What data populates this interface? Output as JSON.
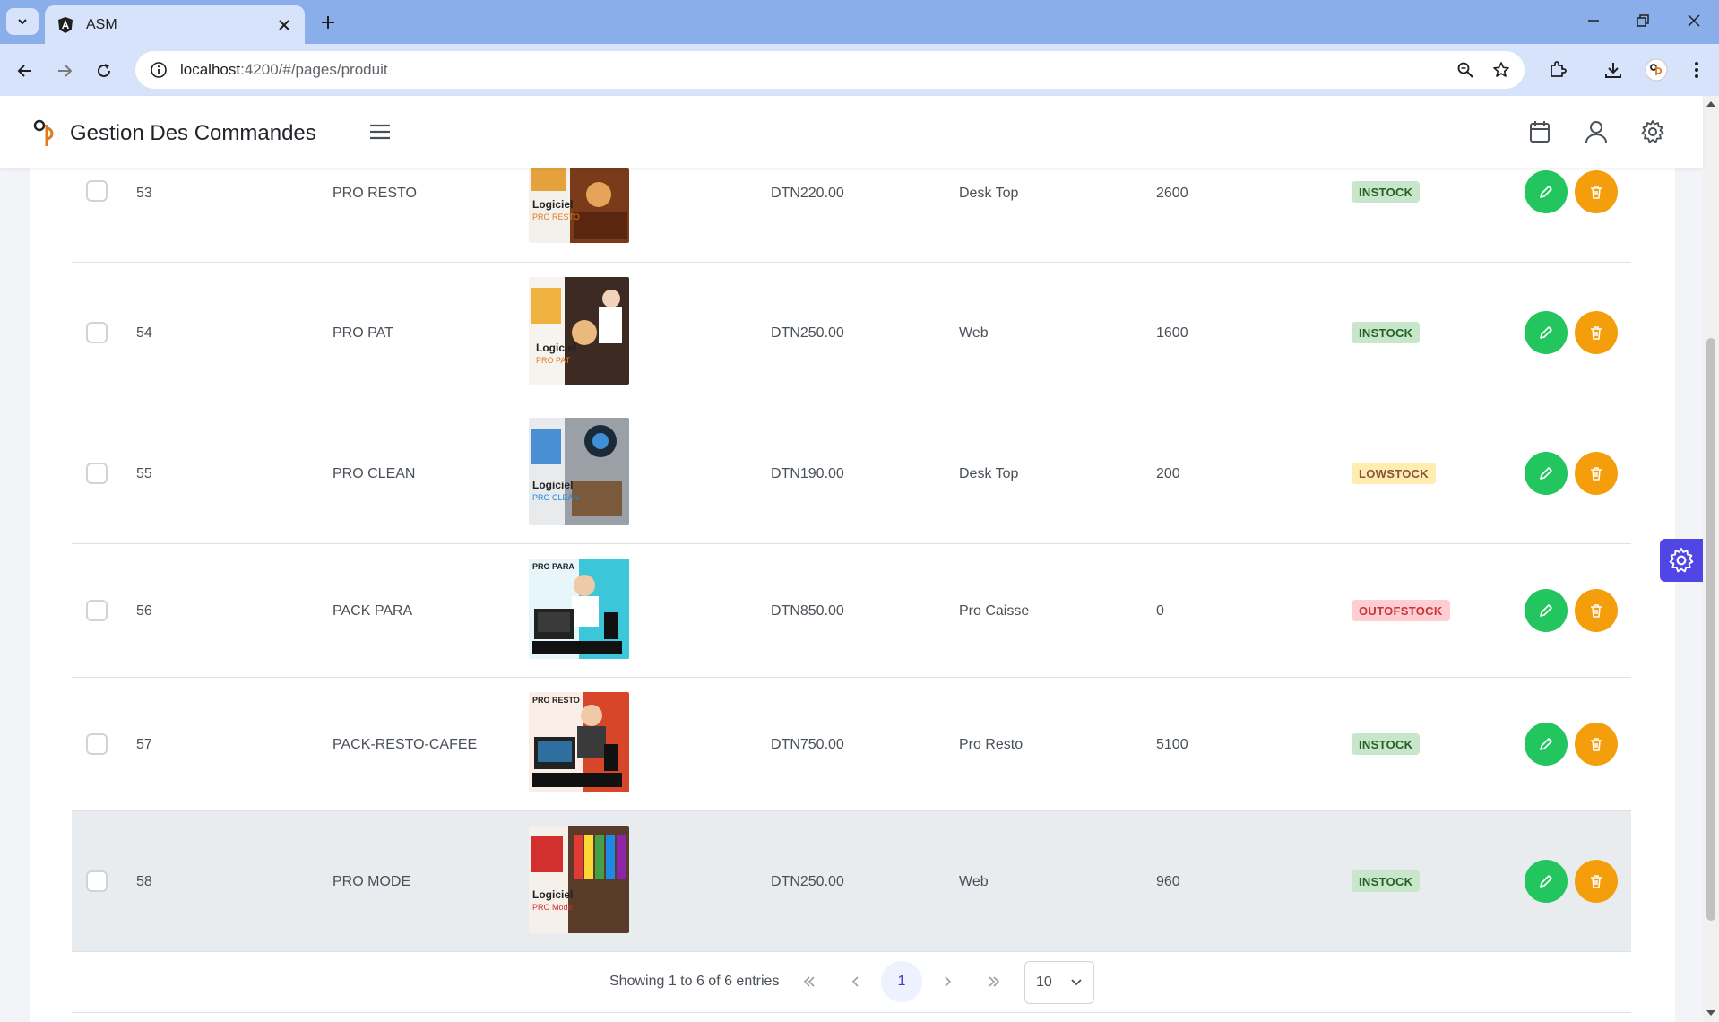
{
  "browser": {
    "tab_title": "ASM",
    "url_host": "localhost",
    "url_rest": ":4200/#/pages/produit"
  },
  "app": {
    "title": "Gestion Des Commandes"
  },
  "products": [
    {
      "id": "53",
      "name": "PRO RESTO",
      "price": "DTN220.00",
      "category": "Desk Top",
      "quantity": "2600",
      "status": "INSTOCK",
      "img_caption": "Logiciel",
      "img_sub": "PRO RESTO"
    },
    {
      "id": "54",
      "name": "PRO PAT",
      "price": "DTN250.00",
      "category": "Web",
      "quantity": "1600",
      "status": "INSTOCK",
      "img_caption": "Logiciel",
      "img_sub": "PRO PAT"
    },
    {
      "id": "55",
      "name": "PRO CLEAN",
      "price": "DTN190.00",
      "category": "Desk Top",
      "quantity": "200",
      "status": "LOWSTOCK",
      "img_caption": "Logiciel",
      "img_sub": "PRO CLEAN"
    },
    {
      "id": "56",
      "name": "PACK PARA",
      "price": "DTN850.00",
      "category": "Pro Caisse",
      "quantity": "0",
      "status": "OUTOFSTOCK",
      "img_caption": "",
      "img_sub": "PRO PARA"
    },
    {
      "id": "57",
      "name": "PACK-RESTO-CAFEE",
      "price": "DTN750.00",
      "category": "Pro Resto",
      "quantity": "5100",
      "status": "INSTOCK",
      "img_caption": "",
      "img_sub": "PRO RESTO"
    },
    {
      "id": "58",
      "name": "PRO MODE",
      "price": "DTN250.00",
      "category": "Web",
      "quantity": "960",
      "status": "INSTOCK",
      "img_caption": "Logiciel",
      "img_sub": "PRO Mode"
    }
  ],
  "paginator": {
    "summary": "Showing 1 to 6 of 6 entries",
    "current_page": "1",
    "rows_per_page": "10"
  },
  "colors": {
    "edit": "#22c55e",
    "delete": "#f59e0b",
    "accent": "#4f46e5"
  }
}
